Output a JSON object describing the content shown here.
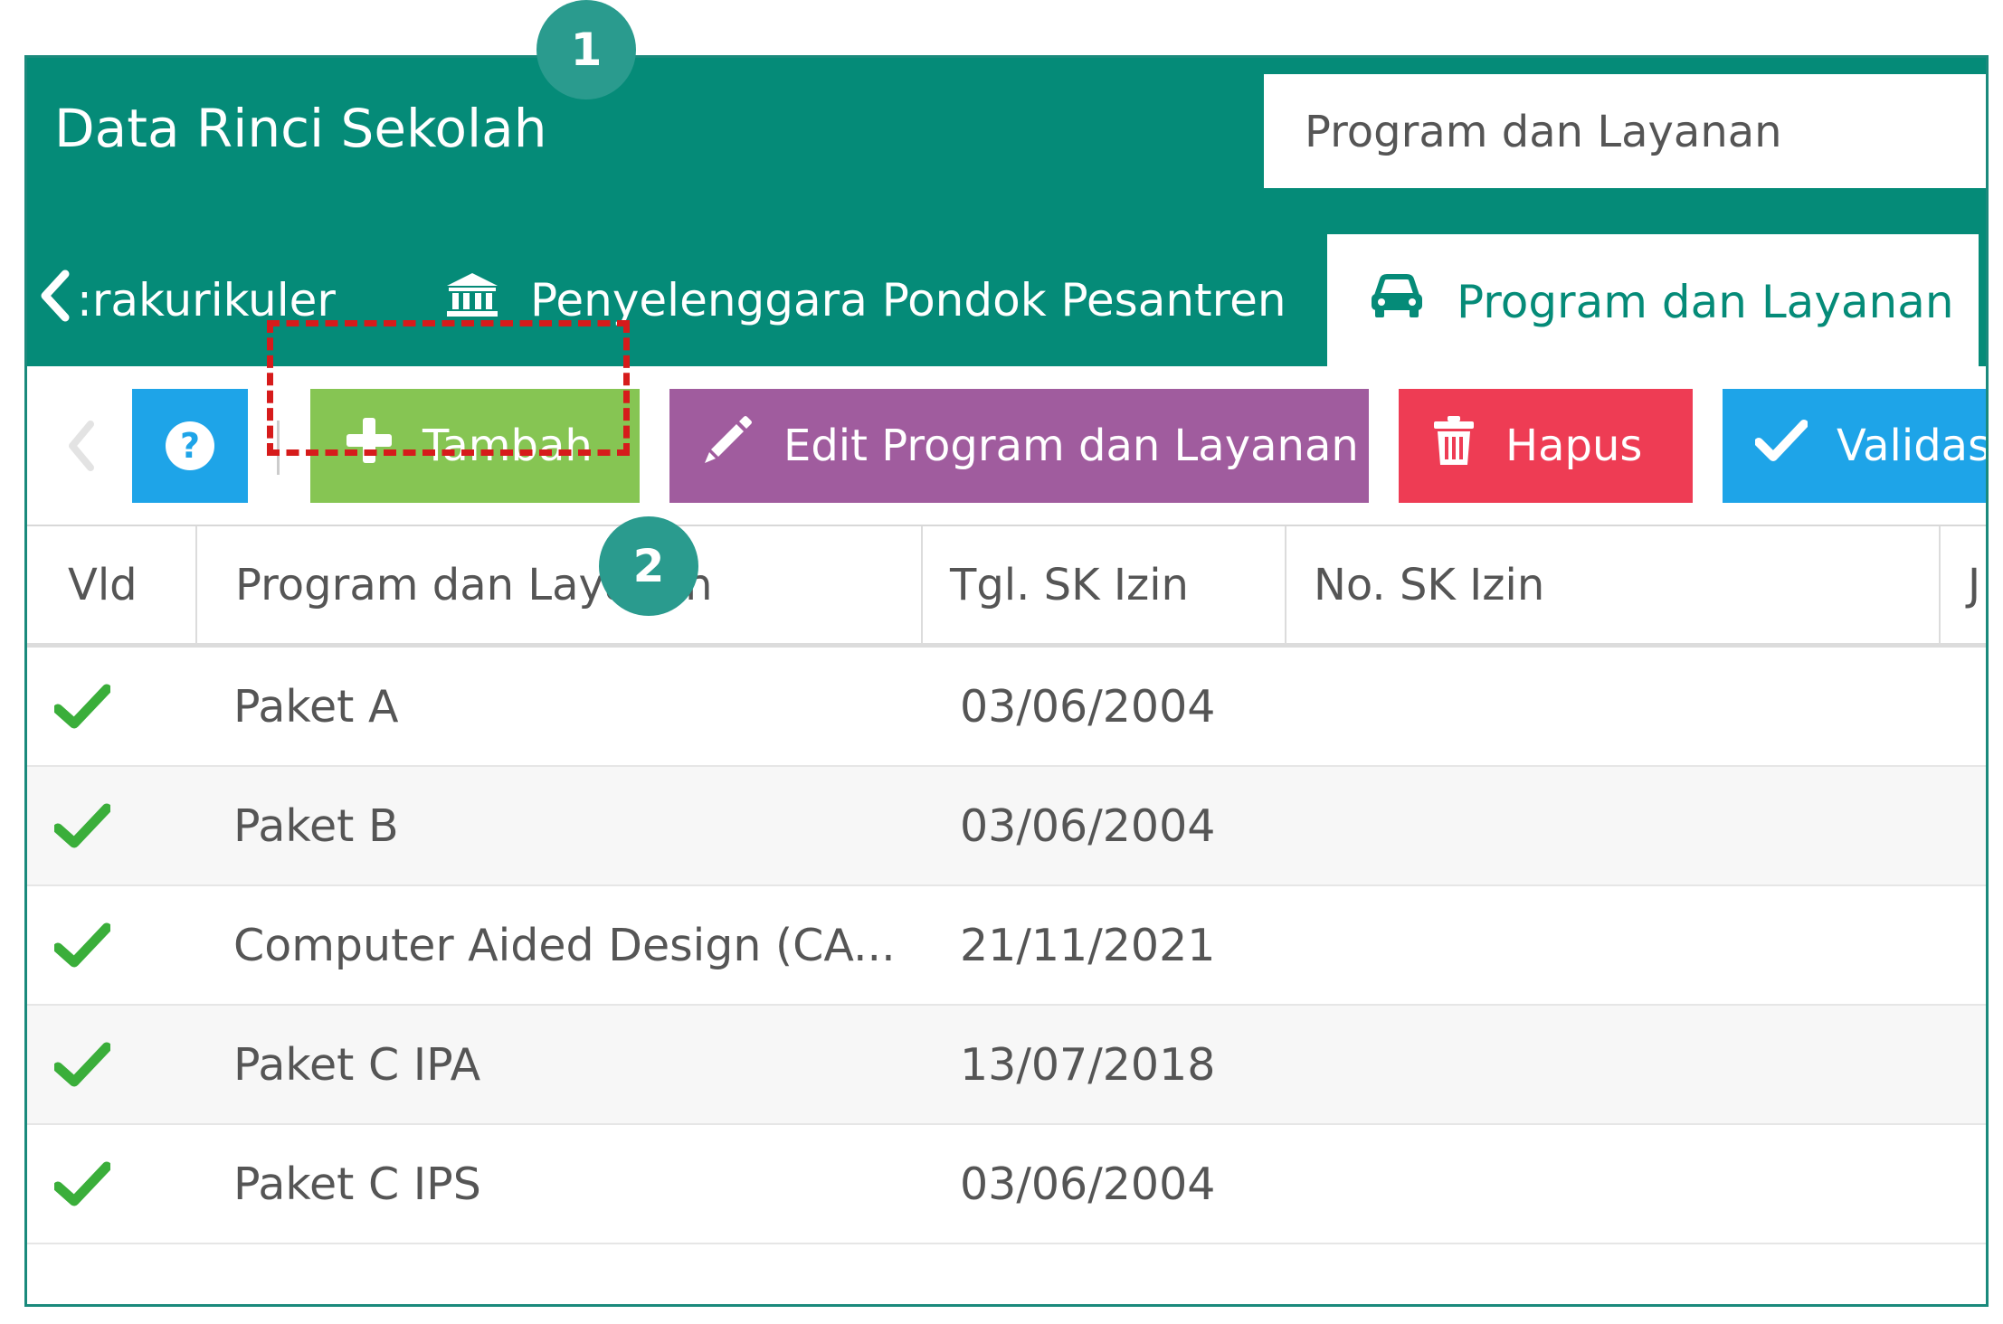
{
  "app": {
    "title": "Data Rinci Sekolah"
  },
  "section_select": {
    "value": "Program dan Layanan"
  },
  "tabs": [
    {
      "label": ":rakurikuler",
      "icon": "chevron-left-icon"
    },
    {
      "label": "Penyelenggara Pondok Pesantren",
      "icon": "bank-icon"
    },
    {
      "label": "Program dan Layanan",
      "icon": "car-icon",
      "active": true
    }
  ],
  "toolbar": {
    "help_icon": "question-circle-icon",
    "tambah_label": "Tambah",
    "edit_label": "Edit Program dan Layanan",
    "hapus_label": "Hapus",
    "validasi_label": "Validas"
  },
  "table": {
    "columns": [
      "Vld",
      "Program dan Layanan",
      "Tgl. SK Izin",
      "No. SK Izin",
      "J"
    ],
    "rows": [
      {
        "vld": "check",
        "program": "Paket A",
        "tgl": "03/06/2004",
        "no": ""
      },
      {
        "vld": "check",
        "program": "Paket B",
        "tgl": "03/06/2004",
        "no": ""
      },
      {
        "vld": "check",
        "program": "Computer Aided Design (CA...",
        "tgl": "21/11/2021",
        "no": ""
      },
      {
        "vld": "check",
        "program": "Paket C IPA",
        "tgl": "13/07/2018",
        "no": ""
      },
      {
        "vld": "check",
        "program": "Paket C IPS",
        "tgl": "03/06/2004",
        "no": ""
      }
    ]
  },
  "callouts": {
    "one": "1",
    "two": "2"
  },
  "colors": {
    "header_bg": "#058b78",
    "tambah": "#86c553",
    "edit": "#a05c9e",
    "hapus": "#ee3c54",
    "validasi": "#1ea4e8",
    "callout": "#2a9b8e",
    "highlight": "#d61b1b"
  }
}
